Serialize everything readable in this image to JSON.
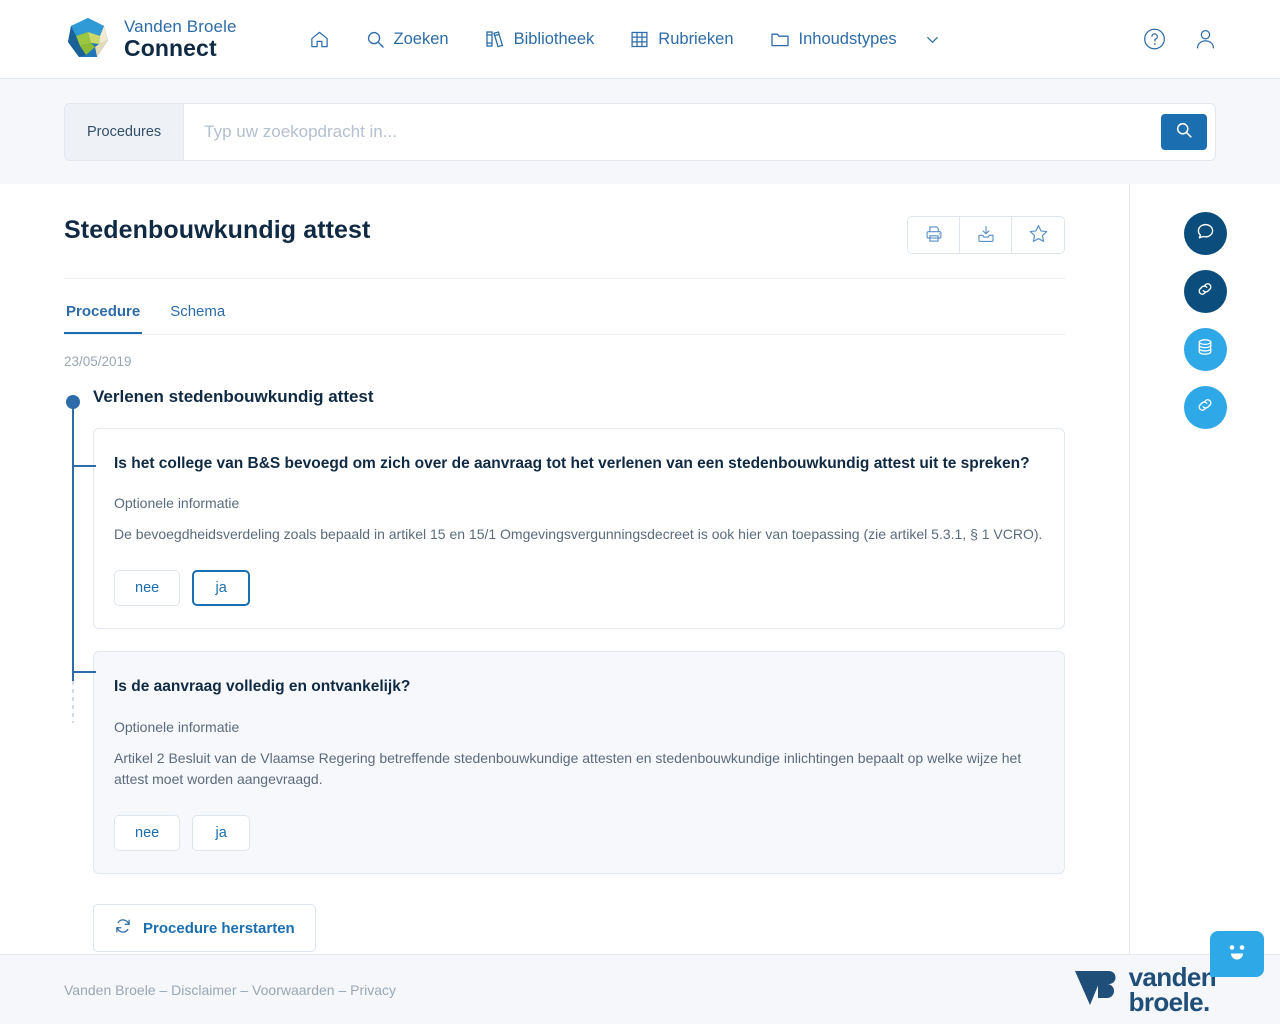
{
  "header": {
    "brand_top": "Vanden Broele",
    "brand_bottom": "Connect",
    "logo_icon": "vanden-broele-sphere-logo",
    "nav": [
      {
        "label": "",
        "icon": "home-icon",
        "name": "home"
      },
      {
        "label": "Zoeken",
        "icon": "search-icon",
        "name": "zoeken"
      },
      {
        "label": "Bibliotheek",
        "icon": "books-icon",
        "name": "bibliotheek"
      },
      {
        "label": "Rubrieken",
        "icon": "grid-icon",
        "name": "rubrieken"
      },
      {
        "label": "Inhoudstypes",
        "icon": "folder-icon",
        "name": "inhoudstypes",
        "caret": "chevron-down-icon"
      }
    ],
    "help_icon": "question-circle-icon",
    "account_icon": "user-icon"
  },
  "search": {
    "scope_label": "Procedures",
    "placeholder": "Typ uw zoekopdracht in...",
    "value": "",
    "submit_icon": "search-icon",
    "submit_color": "#1b6eb0"
  },
  "document": {
    "title": "Stedenbouwkundig attest",
    "toolbar": [
      {
        "name": "print-button",
        "icon": "printer-icon"
      },
      {
        "name": "download-button",
        "icon": "download-inbox-icon"
      },
      {
        "name": "favorite-button",
        "icon": "star-icon"
      }
    ],
    "tabs": [
      {
        "label": "Procedure",
        "active": true
      },
      {
        "label": "Schema",
        "active": false
      }
    ],
    "date": "23/05/2019",
    "stage_title": "Verlenen stedenbouwkundig attest",
    "questions": [
      {
        "title": "Is het college van B&S bevoegd om zich over de aanvraag tot het verlenen van een stedenbouwkundig attest uit te spreken?",
        "info_label": "Optionele informatie",
        "info_text": "De bevoegdheidsverdeling zoals bepaald in artikel 15 en 15/1 Omgevingsvergunningsdecreet is ook hier van toepassing (zie artikel 5.3.1, § 1 VCRO).",
        "answers": [
          {
            "label": "nee",
            "selected": false
          },
          {
            "label": "ja",
            "selected": true
          }
        ],
        "muted": false
      },
      {
        "title": "Is de aanvraag volledig en ontvankelijk?",
        "info_label": "Optionele informatie",
        "info_text": "Artikel 2 Besluit van de Vlaamse Regering betreffende stedenbouwkundige attesten en stedenbouwkundige inlichtingen bepaalt op welke wijze het attest moet worden aangevraagd.",
        "answers": [
          {
            "label": "nee",
            "selected": false
          },
          {
            "label": "ja",
            "selected": false
          }
        ],
        "muted": true
      }
    ],
    "restart_label": "Procedure herstarten",
    "restart_icon": "refresh-icon"
  },
  "rail": {
    "buttons": [
      {
        "name": "comments-button",
        "icon": "speech-bubble-icon",
        "color": "#0b4e7e"
      },
      {
        "name": "links-button",
        "icon": "chain-link-icon",
        "color": "#0b4e7e"
      },
      {
        "name": "database-button",
        "icon": "database-stack-icon",
        "color": "#2fa8e8"
      },
      {
        "name": "related-links-button",
        "icon": "chain-link-icon",
        "color": "#2fa8e8"
      }
    ]
  },
  "footer": {
    "links_text": "Vanden Broele – Disclaimer – Voorwaarden – Privacy",
    "logo_line1": "vanden",
    "logo_line2": "broele.",
    "chat_icon": "chat-smiley-icon"
  }
}
